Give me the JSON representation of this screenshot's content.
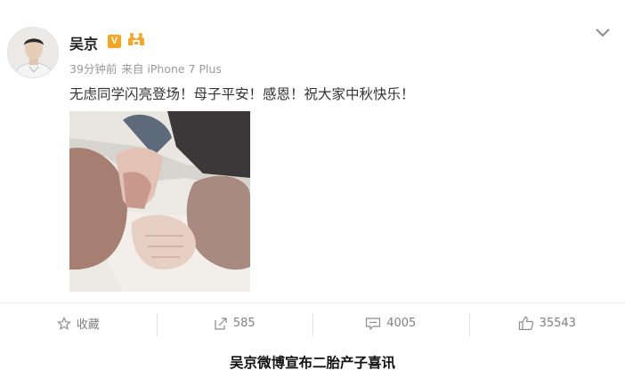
{
  "post": {
    "username": "吴京",
    "verified_mark": "V",
    "time": "39分钟前",
    "source": "来自 iPhone 7 Plus",
    "text": "无虑同学闪亮登场！母子平安！感恩！祝大家中秋快乐！"
  },
  "actions": {
    "favorite_label": "收藏",
    "repost_count": "585",
    "comment_count": "4005",
    "like_count": "35543"
  },
  "caption": "吴京微博宣布二胎产子喜讯",
  "colors": {
    "verified": "#f6a623",
    "member_badge": "#f6a623",
    "meta_text": "#999999",
    "action_text": "#808080"
  }
}
